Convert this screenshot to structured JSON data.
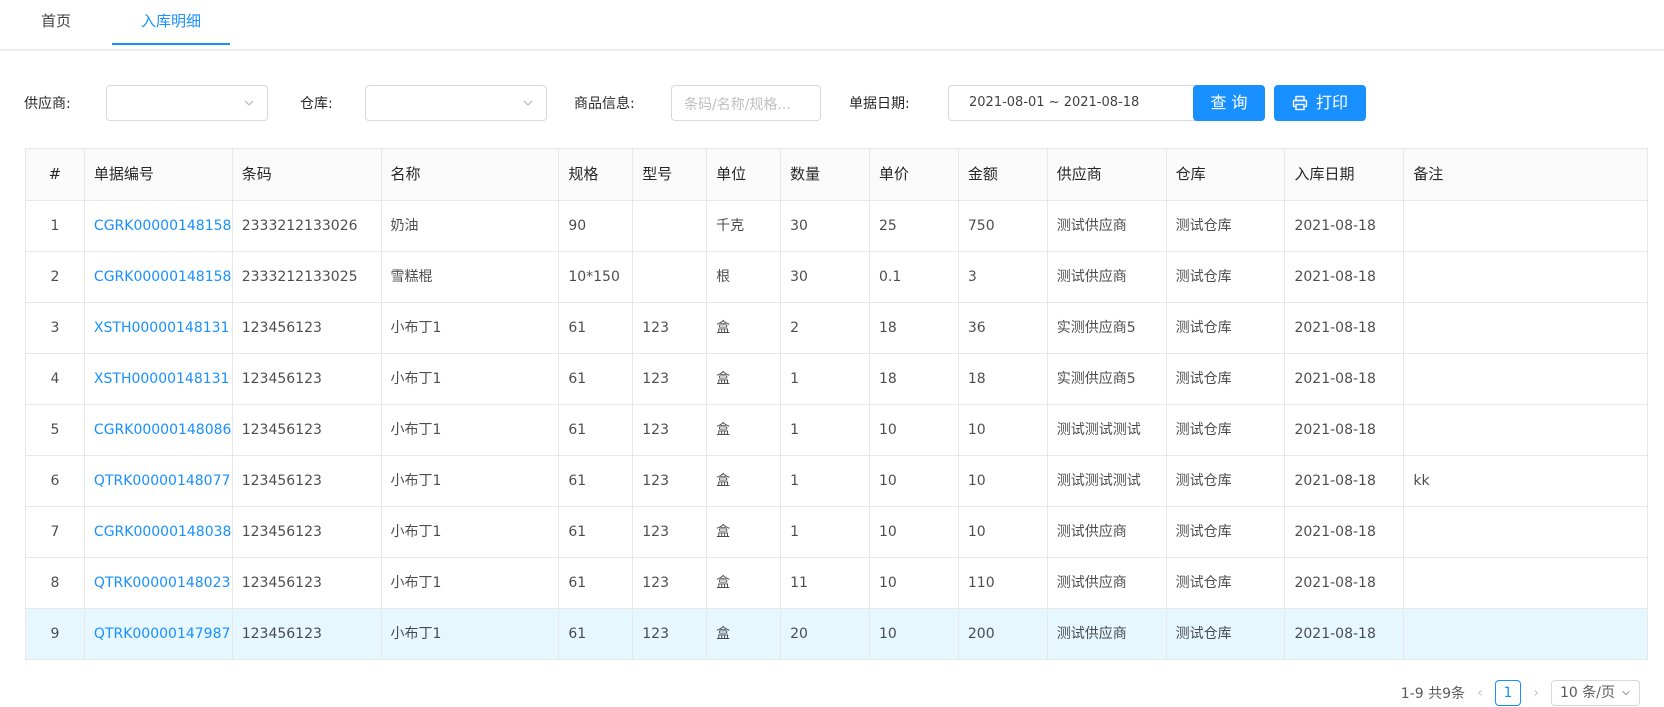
{
  "tabs": [
    {
      "label": "首页"
    },
    {
      "label": "入库明细"
    }
  ],
  "filters": {
    "supplier_label": "供应商:",
    "warehouse_label": "仓库:",
    "goods_label": "商品信息:",
    "goods_placeholder": "条码/名称/规格...",
    "date_label": "单据日期:",
    "date_range": "2021-08-01 ~ 2021-08-18",
    "query_label": "查 询",
    "print_label": "打印"
  },
  "table": {
    "headers": [
      "#",
      "单据编号",
      "条码",
      "名称",
      "规格",
      "型号",
      "单位",
      "数量",
      "单价",
      "金额",
      "供应商",
      "仓库",
      "入库日期",
      "备注"
    ],
    "rows": [
      [
        "1",
        "CGRK00000148158",
        "2333212133026",
        "奶油",
        "90",
        "",
        "千克",
        "30",
        "25",
        "750",
        "测试供应商",
        "测试仓库",
        "2021-08-18",
        ""
      ],
      [
        "2",
        "CGRK00000148158",
        "2333212133025",
        "雪糕棍",
        "10*150",
        "",
        "根",
        "30",
        "0.1",
        "3",
        "测试供应商",
        "测试仓库",
        "2021-08-18",
        ""
      ],
      [
        "3",
        "XSTH00000148131",
        "123456123",
        "小布丁1",
        "61",
        "123",
        "盒",
        "2",
        "18",
        "36",
        "实测供应商5",
        "测试仓库",
        "2021-08-18",
        ""
      ],
      [
        "4",
        "XSTH00000148131",
        "123456123",
        "小布丁1",
        "61",
        "123",
        "盒",
        "1",
        "18",
        "18",
        "实测供应商5",
        "测试仓库",
        "2021-08-18",
        ""
      ],
      [
        "5",
        "CGRK00000148086",
        "123456123",
        "小布丁1",
        "61",
        "123",
        "盒",
        "1",
        "10",
        "10",
        "测试测试测试",
        "测试仓库",
        "2021-08-18",
        ""
      ],
      [
        "6",
        "QTRK00000148077",
        "123456123",
        "小布丁1",
        "61",
        "123",
        "盒",
        "1",
        "10",
        "10",
        "测试测试测试",
        "测试仓库",
        "2021-08-18",
        "kk"
      ],
      [
        "7",
        "CGRK00000148038",
        "123456123",
        "小布丁1",
        "61",
        "123",
        "盒",
        "1",
        "10",
        "10",
        "测试供应商",
        "测试仓库",
        "2021-08-18",
        ""
      ],
      [
        "8",
        "QTRK00000148023",
        "123456123",
        "小布丁1",
        "61",
        "123",
        "盒",
        "11",
        "10",
        "110",
        "测试供应商",
        "测试仓库",
        "2021-08-18",
        ""
      ],
      [
        "9",
        "QTRK00000147987",
        "123456123",
        "小布丁1",
        "61",
        "123",
        "盒",
        "20",
        "10",
        "200",
        "测试供应商",
        "测试仓库",
        "2021-08-18",
        ""
      ]
    ]
  },
  "pagination": {
    "total_text": "1-9 共9条",
    "prev_glyph": "‹",
    "next_glyph": "›",
    "current_page": "1",
    "page_size": "10 条/页"
  },
  "colors": {
    "accent": "#1890ff",
    "highlight_row": "#e6f7ff"
  },
  "icons": [
    "chevron-down-icon",
    "printer-icon"
  ]
}
